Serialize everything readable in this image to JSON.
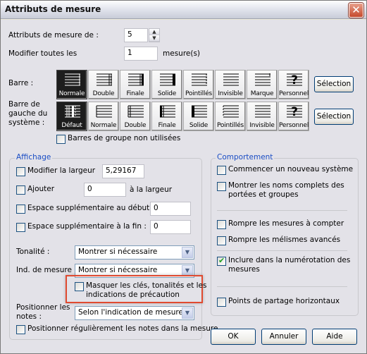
{
  "window": {
    "title": "Attributs de mesure"
  },
  "top": {
    "measure_attrs_label": "Attributs de mesure de :",
    "measure_attrs_value": "5",
    "modify_every_label": "Modifier toutes les",
    "modify_every_value": "1",
    "modify_every_unit": "mesure(s)"
  },
  "barline": {
    "label": "Barre :",
    "options": [
      "Normale",
      "Double",
      "Finale",
      "Solide",
      "Pointillés",
      "Invisible",
      "Marque",
      "Personnel"
    ],
    "selected": "Normale",
    "selection_button": "Sélection"
  },
  "left_barline": {
    "label": "Barre de gauche du système :",
    "options": [
      "Défaut",
      "Normale",
      "Double",
      "Finale",
      "Solide",
      "Pointillés",
      "Invisible",
      "Personnel"
    ],
    "selected": "Défaut",
    "selection_button": "Sélection",
    "unused_group_bars_label": "Barres de groupe non utilisées",
    "unused_group_bars_checked": false
  },
  "display": {
    "title": "Affichage",
    "modify_width_label": "Modifier la largeur",
    "modify_width_checked": false,
    "modify_width_value": "5,29167",
    "add_label": "Ajouter",
    "add_checked": false,
    "add_value": "0",
    "add_suffix": "à la largeur",
    "extra_start_label": "Espace supplémentaire au début",
    "extra_start_checked": false,
    "extra_start_value": "0",
    "extra_end_label": "Espace supplémentaire à la fin :",
    "extra_end_checked": false,
    "extra_end_value": "0",
    "key_label": "Tonalité :",
    "key_value": "Montrer si nécessaire",
    "time_sig_label": "Ind. de mesure",
    "time_sig_value": "Montrer si nécessaire",
    "hide_cautionary_label_1": "Masquer les clés, tonalités et les",
    "hide_cautionary_label_2": "indications de précaution",
    "hide_cautionary_checked": false,
    "position_notes_label_1": "Positionner les",
    "position_notes_label_2": "notes :",
    "position_notes_value": "Selon l'indication de mesure",
    "evenly_position_label": "Positionner régulièrement les notes dans la mesure",
    "evenly_position_checked": false
  },
  "behavior": {
    "title": "Comportement",
    "new_system_label": "Commencer un nouveau système",
    "new_system_checked": false,
    "full_names_label_1": "Montrer les noms complets des",
    "full_names_label_2": "portées et groupes",
    "full_names_checked": false,
    "break_rests_label": "Rompre les mesures à compter",
    "break_rests_checked": false,
    "break_melismas_label": "Rompre les mélismes avancés",
    "break_melismas_checked": false,
    "include_numbering_label_1": "Inclure dans la numérotation des",
    "include_numbering_label_2": "mesures",
    "include_numbering_checked": true,
    "split_points_label": "Points de partage horizontaux",
    "split_points_checked": false
  },
  "buttons": {
    "ok": "OK",
    "cancel": "Annuler",
    "help": "Aide"
  },
  "colors": {
    "group_title": "#1a4dc4",
    "highlight": "#e04a30",
    "check": "#21a121"
  }
}
